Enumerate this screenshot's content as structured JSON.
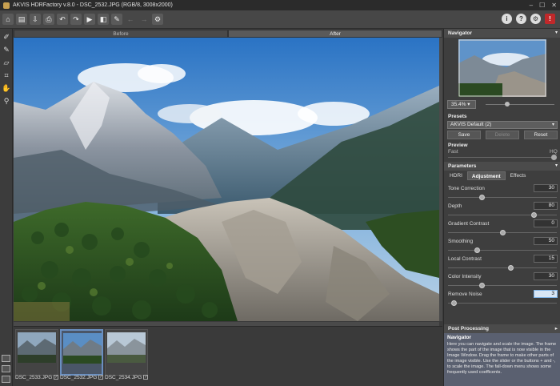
{
  "window": {
    "title": "AKVIS HDRFactory v.8.0 - DSC_2532.JPG (RGB/8, 3008x2000)"
  },
  "toolbar": {
    "left_icons": [
      "home-icon",
      "open-icon",
      "save-icon",
      "print-icon",
      "undo-icon",
      "redo-icon",
      "run-icon",
      "compare-icon",
      "before-after-icon",
      "back-icon",
      "forward-icon",
      "batch-icon"
    ],
    "right_icons": [
      "info-icon",
      "help-icon",
      "settings-icon",
      "alert-icon"
    ]
  },
  "view_tabs": {
    "before": "Before",
    "after": "After"
  },
  "left_tools": [
    "eyedropper-icon",
    "brush-icon",
    "eraser-icon",
    "crop-icon",
    "hand-icon",
    "zoom-icon"
  ],
  "filmstrip": [
    {
      "name": "DSC_2533.JPG",
      "checked": true,
      "selected": false
    },
    {
      "name": "DSC_2532.JPG",
      "checked": true,
      "selected": true
    },
    {
      "name": "DSC_2534.JPG",
      "checked": true,
      "selected": false
    }
  ],
  "navigator": {
    "title": "Navigator",
    "zoom": "35.4%"
  },
  "presets": {
    "title": "Presets",
    "selected": "AKVIS Default (2)",
    "save": "Save",
    "delete": "Delete",
    "reset": "Reset"
  },
  "preview": {
    "title": "Preview",
    "fast": "Fast",
    "hq": "HQ"
  },
  "parameters": {
    "title": "Parameters",
    "tabs": [
      "HDRI",
      "Adjustment",
      "Effects"
    ],
    "active_tab": "Adjustment",
    "items": [
      {
        "name": "Tone Correction",
        "value": "30",
        "level": 0.3
      },
      {
        "name": "Depth",
        "value": "80",
        "level": 0.8
      },
      {
        "name": "Gradient Contrast",
        "value": "0",
        "level": 0.5
      },
      {
        "name": "Smoothing",
        "value": "50",
        "level": 0.25
      },
      {
        "name": "Local Contrast",
        "value": "15",
        "level": 0.58
      },
      {
        "name": "Color Intensity",
        "value": "30",
        "level": 0.3
      },
      {
        "name": "Remove Noise",
        "value": "3",
        "level": 0.03
      }
    ]
  },
  "post_processing": {
    "title": "Post Processing"
  },
  "help": {
    "title": "Navigator",
    "text": "Here you can navigate and scale the image. The frame shows the part of the image that is now visible in the Image Window. Drag the frame to make other parts of the image visible. Use the slider or the buttons + and -, to scale the image. The fall-down menu shows some frequently used coefficents."
  },
  "colors": {
    "accent": "#6a8fc0",
    "panel": "#3e3e3e",
    "help_bg": "#5a6070"
  }
}
